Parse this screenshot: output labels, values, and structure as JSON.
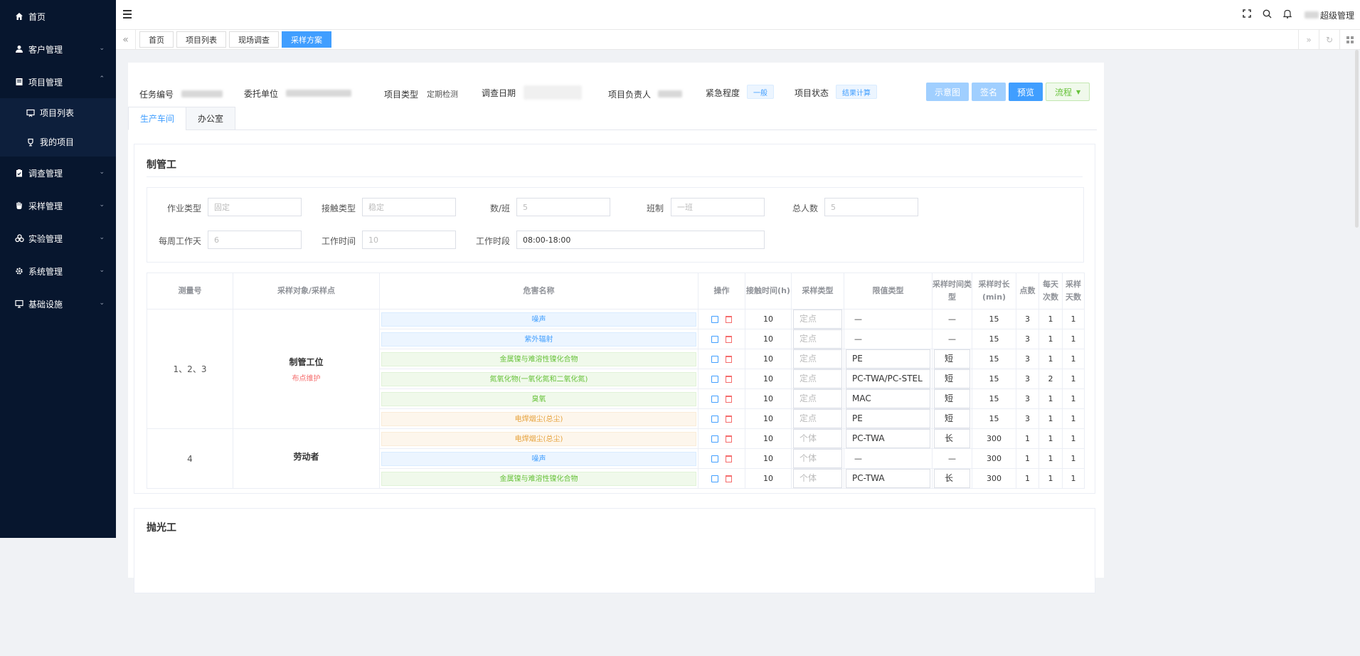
{
  "sidebar": {
    "items": [
      {
        "label": "首页",
        "icon": "home-icon",
        "expanded": false
      },
      {
        "label": "客户管理",
        "icon": "user-icon",
        "expanded": false
      },
      {
        "label": "项目管理",
        "icon": "book-icon",
        "expanded": true
      },
      {
        "label": "调查管理",
        "icon": "clipboard-icon",
        "expanded": false
      },
      {
        "label": "采样管理",
        "icon": "hand-icon",
        "expanded": false
      },
      {
        "label": "实验管理",
        "icon": "lab-icon",
        "expanded": false
      },
      {
        "label": "系统管理",
        "icon": "gear-icon",
        "expanded": false
      },
      {
        "label": "基础设施",
        "icon": "monitor-icon",
        "expanded": false
      }
    ],
    "project_sub": [
      {
        "label": "项目列表",
        "icon": "presentation-icon"
      },
      {
        "label": "我的项目",
        "icon": "trophy-icon"
      }
    ]
  },
  "topbar": {
    "user_label": "超级管理"
  },
  "tabs": [
    "首页",
    "项目列表",
    "现场调查",
    "采样方案"
  ],
  "active_tab": "采样方案",
  "info": {
    "task_no_label": "任务编号",
    "client_label": "委托单位",
    "type_label": "项目类型",
    "type_value": "定期检测",
    "date_label": "调查日期",
    "owner_label": "项目负责人",
    "urgency_label": "紧急程度",
    "urgency_value": "一般",
    "status_label": "项目状态",
    "status_value": "结果计算"
  },
  "buttons": {
    "diagram": "示意图",
    "sign": "签名",
    "preview": "预览",
    "flow": "流程"
  },
  "sub_tabs": [
    "生产车间",
    "办公室"
  ],
  "section": {
    "title": "制管工",
    "form": {
      "job_type_label": "作业类型",
      "job_type_value": "固定",
      "contact_type_label": "接触类型",
      "contact_type_value": "稳定",
      "per_shift_label": "数/班",
      "per_shift_value": "5",
      "shift_label": "班制",
      "shift_value": "一班",
      "total_label": "总人数",
      "total_value": "5",
      "days_label": "每周工作天",
      "days_value": "6",
      "hours_label": "工作时间",
      "hours_value": "10",
      "period_label": "工作时段",
      "period_value": "08:00-18:00"
    },
    "table": {
      "headers": [
        "测量号",
        "采样对象/采样点",
        "危害名称",
        "操作",
        "接触时间(h)",
        "采样类型",
        "限值类型",
        "采样时间类型",
        "采样时长(min)",
        "点数",
        "每天次数",
        "采样天数"
      ],
      "groups": [
        {
          "measure": "1、2、3",
          "point": "制管工位",
          "point_note": "布点维护",
          "rows": [
            {
              "hazard": "噪声",
              "color": "blue",
              "time": "10",
              "stype": "定点",
              "limit": "—",
              "ttype": "—",
              "dur": "15",
              "pts": "3",
              "times": "1",
              "days": "1"
            },
            {
              "hazard": "紫外辐射",
              "color": "blue",
              "time": "10",
              "stype": "定点",
              "limit": "—",
              "ttype": "—",
              "dur": "15",
              "pts": "3",
              "times": "1",
              "days": "1"
            },
            {
              "hazard": "金属镍与难溶性镍化合物",
              "color": "green",
              "time": "10",
              "stype": "定点",
              "limit": "PE",
              "ttype": "短",
              "dur": "15",
              "pts": "3",
              "times": "1",
              "days": "1"
            },
            {
              "hazard": "氮氧化物(一氧化氮和二氧化氮)",
              "color": "green",
              "time": "10",
              "stype": "定点",
              "limit": "PC-TWA/PC-STEL",
              "ttype": "短",
              "dur": "15",
              "pts": "3",
              "times": "2",
              "days": "1"
            },
            {
              "hazard": "臭氧",
              "color": "green",
              "time": "10",
              "stype": "定点",
              "limit": "MAC",
              "ttype": "短",
              "dur": "15",
              "pts": "3",
              "times": "1",
              "days": "1"
            },
            {
              "hazard": "电焊烟尘(总尘)",
              "color": "orange",
              "time": "10",
              "stype": "定点",
              "limit": "PE",
              "ttype": "短",
              "dur": "15",
              "pts": "3",
              "times": "1",
              "days": "1"
            }
          ]
        },
        {
          "measure": "4",
          "point": "劳动者",
          "point_note": "",
          "rows": [
            {
              "hazard": "电焊烟尘(总尘)",
              "color": "orange",
              "time": "10",
              "stype": "个体",
              "limit": "PC-TWA",
              "ttype": "长",
              "dur": "300",
              "pts": "1",
              "times": "1",
              "days": "1"
            },
            {
              "hazard": "噪声",
              "color": "blue",
              "time": "10",
              "stype": "个体",
              "limit": "—",
              "ttype": "—",
              "dur": "300",
              "pts": "1",
              "times": "1",
              "days": "1"
            },
            {
              "hazard": "金属镍与难溶性镍化合物",
              "color": "green",
              "time": "10",
              "stype": "个体",
              "limit": "PC-TWA",
              "ttype": "长",
              "dur": "300",
              "pts": "1",
              "times": "1",
              "days": "1"
            }
          ]
        }
      ]
    }
  },
  "section2": {
    "title": "抛光工"
  }
}
